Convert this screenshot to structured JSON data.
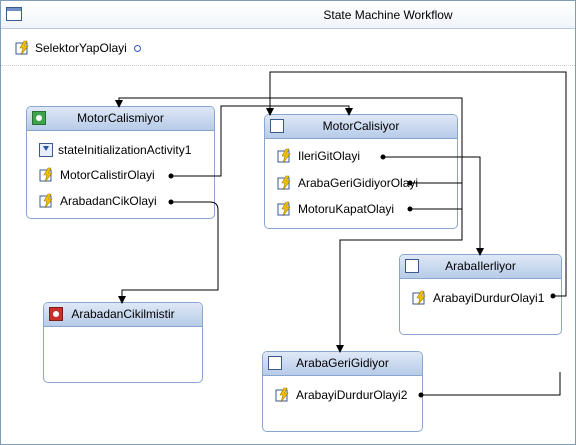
{
  "window": {
    "title": "State Machine Workflow"
  },
  "toolbar": {
    "event_label": "SelektorYapOlayi"
  },
  "states": {
    "motor_calismiyor": {
      "title": "MotorCalismiyor",
      "items": [
        "stateInitializationActivity1",
        "MotorCalistirOlayi",
        "ArabadanCikOlayi"
      ]
    },
    "motor_calisiyor": {
      "title": "MotorCalisiyor",
      "items": [
        "IleriGitOlayi",
        "ArabaGeriGidiyorOlayi",
        "MotoruKapatOlayi"
      ]
    },
    "araba_ilerliyor": {
      "title": "ArabaIlerliyor",
      "items": [
        "ArabayiDurdurOlayi1"
      ]
    },
    "arabadan_cikilmistir": {
      "title": "ArabadanCikilmistir",
      "items": []
    },
    "araba_geri_gidiyor": {
      "title": "ArabaGeriGidiyor",
      "items": [
        "ArabayiDurdurOlayi2"
      ]
    }
  },
  "colors": {
    "header_top": "#dfe8f6",
    "header_bottom": "#b7cbe8",
    "border": "#8aa6cf",
    "connector": "#000000"
  }
}
